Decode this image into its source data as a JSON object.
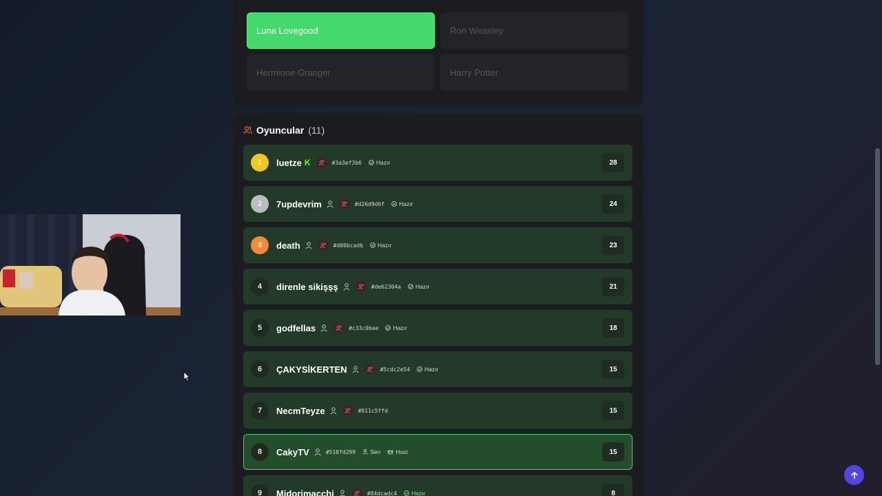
{
  "answers": [
    {
      "label": "Luna Lovegood",
      "selected": true
    },
    {
      "label": "Ron Weasley",
      "selected": false
    },
    {
      "label": "Hermione Granger",
      "selected": false
    },
    {
      "label": "Harry Potter",
      "selected": false
    }
  ],
  "players_panel": {
    "title": "Oyuncular",
    "count": "(11)"
  },
  "players": [
    {
      "rank": "1",
      "name": "luetze",
      "kick_badge": "K",
      "hash": "#3a3ef3b6",
      "status": "Hazır",
      "score": "28",
      "medal": "gold"
    },
    {
      "rank": "2",
      "name": "7updevrim",
      "hash": "#d26d9d6f",
      "status": "Hazır",
      "score": "24",
      "medal": "silver"
    },
    {
      "rank": "3",
      "name": "death",
      "hash": "#d00bcadb",
      "status": "Hazır",
      "score": "23",
      "medal": "bronze"
    },
    {
      "rank": "4",
      "name": "direnle sikişşş",
      "hash": "#de62304a",
      "status": "Hazır",
      "score": "21"
    },
    {
      "rank": "5",
      "name": "godfellas",
      "hash": "#c33c0bae",
      "status": "Hazır",
      "score": "18"
    },
    {
      "rank": "6",
      "name": "ÇAKYSİKERTEN",
      "hash": "#5cdc2e54",
      "status": "Hazır",
      "score": "15"
    },
    {
      "rank": "7",
      "name": "NecmTeyze",
      "hash": "#911c5ffd",
      "status": "",
      "score": "15"
    },
    {
      "rank": "8",
      "name": "CakyTV",
      "hash": "#518fd299",
      "you_label": "Sen",
      "host_label": "Host",
      "score": "15",
      "is_me": true
    },
    {
      "rank": "9",
      "name": "Midorimacchi",
      "hash": "#84dcadc4",
      "status": "Hazır",
      "score": "8"
    }
  ],
  "colors": {
    "accent_green": "#44d96b",
    "row_bg": "#223a27",
    "fab": "#4f46e5",
    "kick_green": "#53fc18"
  }
}
